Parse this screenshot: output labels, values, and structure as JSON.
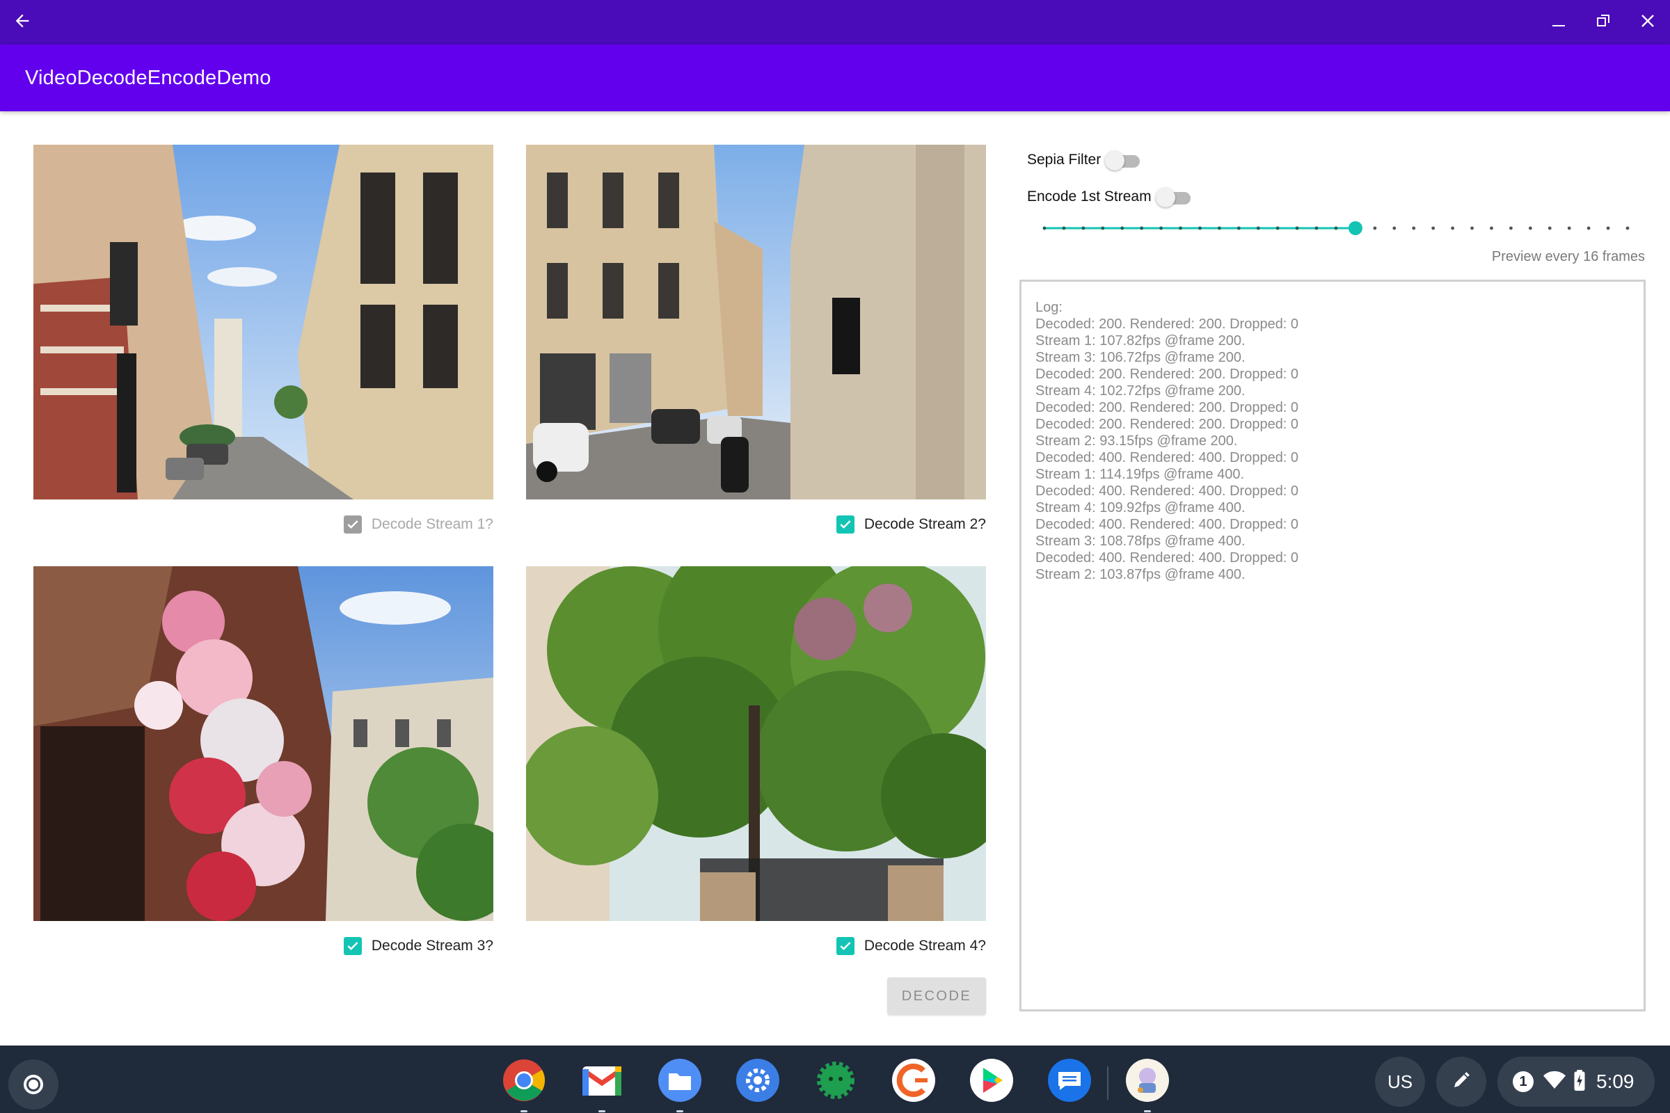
{
  "window": {
    "back_icon": "arrow-left-icon",
    "minimize_icon": "minimize-icon",
    "restore_icon": "restore-icon",
    "close_icon": "close-icon",
    "title_bar_color": "#4a0bb8"
  },
  "app_bar": {
    "title": "VideoDecodeEncodeDemo",
    "color": "#6200ee"
  },
  "streams": [
    {
      "label": "Decode Stream 1?",
      "checked": true,
      "enabled": false
    },
    {
      "label": "Decode Stream 2?",
      "checked": true,
      "enabled": true
    },
    {
      "label": "Decode Stream 3?",
      "checked": true,
      "enabled": true
    },
    {
      "label": "Decode Stream 4?",
      "checked": true,
      "enabled": true
    }
  ],
  "decode_button": {
    "label": "DECODE",
    "enabled": false
  },
  "controls": {
    "sepia_filter": {
      "label": "Sepia Filter",
      "on": false
    },
    "encode_first": {
      "label": "Encode 1st Stream",
      "on": false
    },
    "preview_slider": {
      "steps": 30,
      "selected_step": 16,
      "accent": "#13c4b4"
    },
    "preview_text": "Preview every 16 frames"
  },
  "log": {
    "lines": [
      "Log:",
      "Decoded: 200. Rendered: 200. Dropped: 0",
      "Stream 1: 107.82fps @frame 200.",
      "Stream 3: 106.72fps @frame 200.",
      "Decoded: 200. Rendered: 200. Dropped: 0",
      "Stream 4: 102.72fps @frame 200.",
      "Decoded: 200. Rendered: 200. Dropped: 0",
      "Decoded: 200. Rendered: 200. Dropped: 0",
      "Stream 2: 93.15fps @frame 200.",
      "Decoded: 400. Rendered: 400. Dropped: 0",
      "Stream 1: 114.19fps @frame 400.",
      "Decoded: 400. Rendered: 400. Dropped: 0",
      "Stream 4: 109.92fps @frame 400.",
      "Decoded: 400. Rendered: 400. Dropped: 0",
      "Stream 3: 108.78fps @frame 400.",
      "Decoded: 400. Rendered: 400. Dropped: 0",
      "Stream 2: 103.87fps @frame 400."
    ]
  },
  "shelf": {
    "launcher_icon": "launcher-icon",
    "apps": [
      {
        "name": "chrome-icon",
        "running": true
      },
      {
        "name": "gmail-icon",
        "running": true
      },
      {
        "name": "files-icon",
        "running": true
      },
      {
        "name": "settings-icon",
        "running": false
      },
      {
        "name": "android-app-icon",
        "running": false
      },
      {
        "name": "feedback-app-icon",
        "running": false
      },
      {
        "name": "play-store-icon",
        "running": false
      },
      {
        "name": "messages-icon",
        "running": false
      },
      {
        "name": "video-demo-app-icon",
        "running": true
      }
    ],
    "ime": "US",
    "stylus_icon": "stylus-pen-icon",
    "notification_count": "1",
    "wifi_icon": "wifi-icon",
    "battery_icon": "battery-charging-icon",
    "time": "5:09"
  }
}
